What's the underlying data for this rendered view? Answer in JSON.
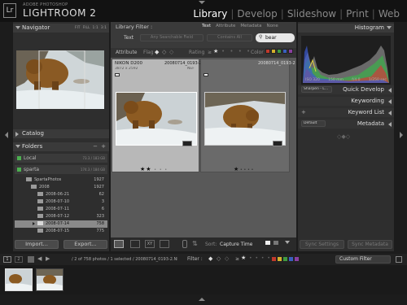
{
  "app": {
    "brand_small": "ADOBE PHOTOSHOP",
    "brand_big": "LIGHTROOM 2",
    "badge": "Lr",
    "modules": [
      "Library",
      "Develop",
      "Slideshow",
      "Print",
      "Web"
    ],
    "active_module": "Library"
  },
  "left_panel": {
    "navigator": {
      "title": "Navigator",
      "zoom_options": [
        "FIT",
        "FILL",
        "1:1",
        "3:1"
      ]
    },
    "catalog": {
      "title": "Catalog"
    },
    "folders": {
      "title": "Folders",
      "add": "+",
      "remove": "−",
      "volumes": [
        {
          "name": "Local",
          "info": "73.3 / 183 GB"
        },
        {
          "name": "sparta",
          "info": "174.3 / 184 GB"
        }
      ],
      "items": [
        {
          "name": "SpartaPhotos",
          "count": "1927"
        },
        {
          "name": "2008",
          "count": "1927"
        },
        {
          "name": "2008-06-21",
          "count": "62"
        },
        {
          "name": "2008-07-10",
          "count": "3"
        },
        {
          "name": "2008-07-11",
          "count": "6"
        },
        {
          "name": "2008-07-12",
          "count": "323"
        },
        {
          "name": "2008-07-14",
          "count": "758"
        },
        {
          "name": "2008-07-15",
          "count": "775"
        }
      ]
    },
    "import_label": "Import...",
    "export_label": "Export..."
  },
  "filter_bar": {
    "title": "Library Filter :",
    "tabs": [
      "Text",
      "Attribute",
      "Metadata",
      "None"
    ],
    "text_label": "Text",
    "field_select": "Any Searchable Field",
    "rule_select": "Contains All",
    "search_value": "bear",
    "attribute_label": "Attribute",
    "flag_label": "Flag",
    "rating_label": "Rating",
    "rating_op": "≥",
    "color_label": "Color",
    "colors": [
      "#c0392b",
      "#d4b02c",
      "#3f9a3f",
      "#3a5fbf",
      "#8a3fa0"
    ]
  },
  "grid": [
    {
      "camera": "NIKON D200",
      "file": "20080714_0193-2",
      "dims": "3872 x 2592",
      "type": "NEF",
      "stars": 2,
      "selected": true
    },
    {
      "camera": "",
      "file": "20080714_0193-2",
      "dims": "",
      "type": "",
      "stars": 1,
      "selected": false
    }
  ],
  "toolbar": {
    "sort_label": "Sort:",
    "sort_value": "Capture Time"
  },
  "right_panel": {
    "histogram": {
      "title": "Histogram",
      "iso": "ISO 320",
      "focal": "150 mm",
      "aperture": "f/4.0",
      "shutter": "1/250 sec"
    },
    "quick_develop": {
      "title": "Quick Develop",
      "preset": "Sharpen - L..."
    },
    "keywording": {
      "title": "Keywording"
    },
    "keyword_list": {
      "title": "Keyword List",
      "add": "+"
    },
    "metadata": {
      "title": "Metadata",
      "preset": "Default"
    },
    "sync_settings": "Sync Settings",
    "sync_metadata": "Sync Metadata"
  },
  "filmstrip": {
    "page_buttons": [
      "1",
      "2"
    ],
    "path_text": "/ 2 of 758 photos / 1 selected / 20080714_0193-2.NEF",
    "filter_label": "Filter :",
    "filter_op": "≥",
    "custom_filter": "Custom Filter"
  }
}
